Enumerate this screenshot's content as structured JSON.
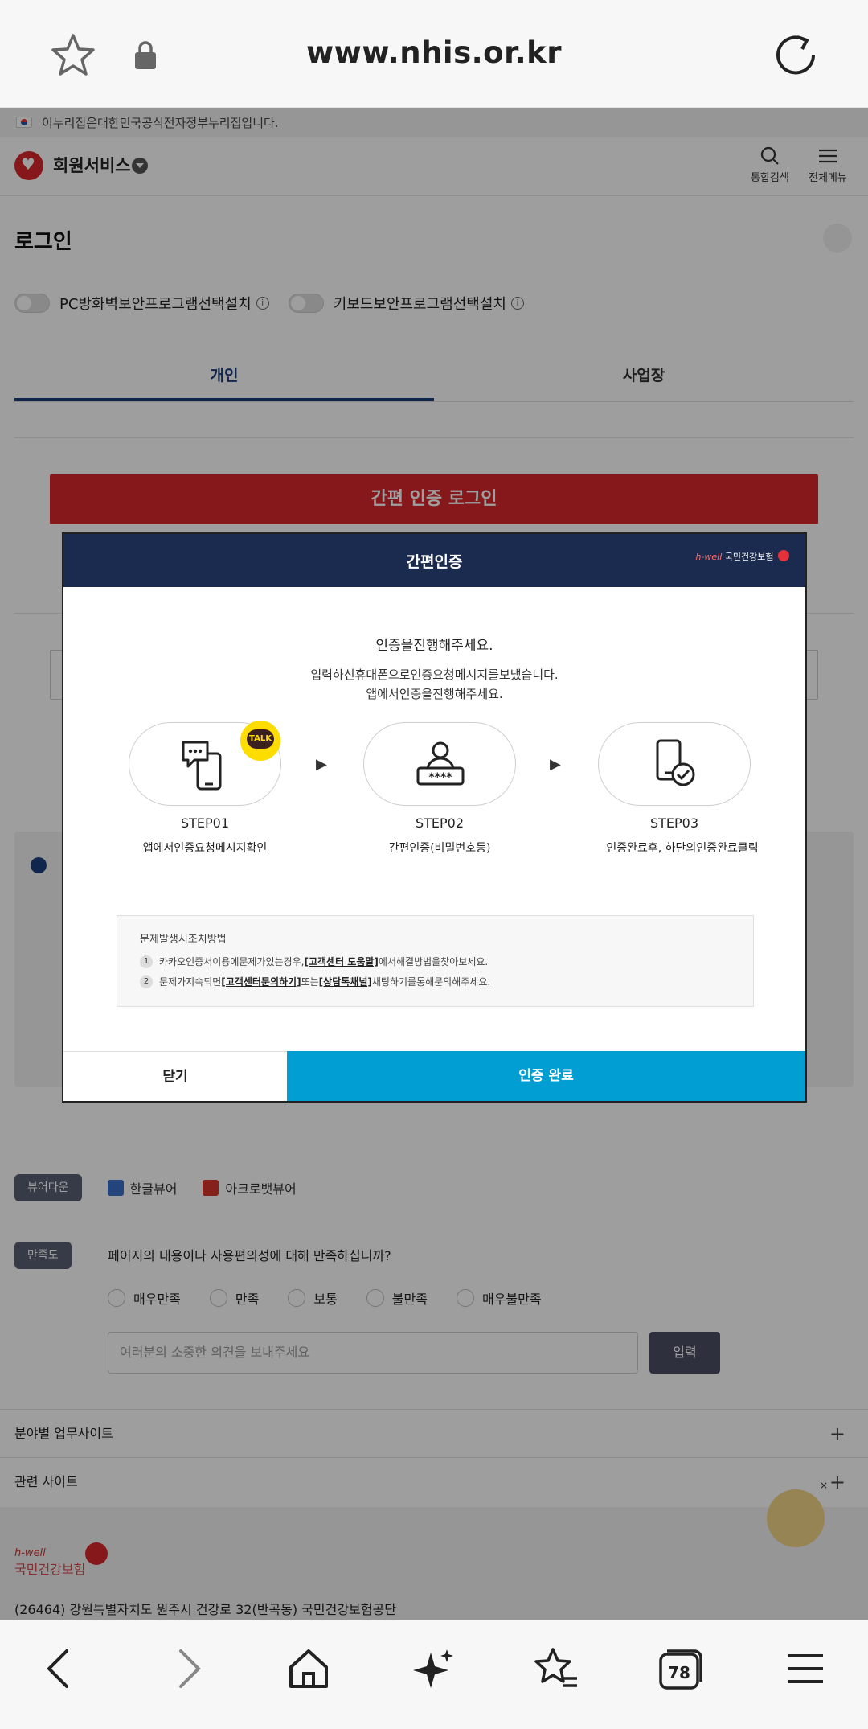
{
  "browser": {
    "url": "www.nhis.or.kr",
    "tab_count": "78"
  },
  "page": {
    "gov_banner": "이누리집은대한민국공식전자정부누리집입니다.",
    "header": {
      "site_title": "회원서비스",
      "search_label": "통합검색",
      "menu_label": "전체메뉴"
    },
    "login_title": "로그인",
    "toggles": {
      "pc_firewall": "PC방화벽보안프로그램선택설치",
      "keyboard_security": "키보드보안프로그램선택설치"
    },
    "tabs": [
      "개인",
      "사업장"
    ],
    "easy_login_button": "간편 인증 로그인",
    "viewer": {
      "label": "뷰어다운",
      "hangul_viewer": "한글뷰어",
      "acrobat_viewer": "아크로뱃뷰어"
    },
    "satisfaction": {
      "label": "만족도",
      "question": "페이지의 내용이나 사용편의성에 대해 만족하십니까?",
      "options": [
        "매우만족",
        "만족",
        "보통",
        "불만족",
        "매우불만족"
      ],
      "placeholder": "여러분의 소중한 의견을 보내주세요",
      "submit": "입력"
    },
    "accordion": {
      "field_sites": "분야별 업무사이트",
      "related_sites": "관련 사이트"
    },
    "footer": {
      "logo_small": "h-well",
      "logo_text": "국민건강보험",
      "address": "(26464) 강원특별자치도 원주시 건강로 32(반곡동) 국민건강보험공단"
    }
  },
  "modal": {
    "title": "간편인증",
    "brand_small": "h-well",
    "brand_text": "국민건강보험",
    "heading": "인증을진행해주세요.",
    "desc_line1": "입력하신휴대폰으로인증요청메시지를보냈습니다.",
    "desc_line2": "앱에서인증을진행해주세요.",
    "talk_badge": "TALK",
    "steps": [
      {
        "label": "STEP01",
        "desc": "앱에서인증요청메시지확인",
        "icon": "chat-phone-icon"
      },
      {
        "label": "STEP02",
        "desc": "간편인증(비밀번호등)",
        "icon": "user-password-icon"
      },
      {
        "label": "STEP03",
        "desc": "인증완료후, 하단의인증완료클릭",
        "icon": "phone-check-icon"
      }
    ],
    "help": {
      "title": "문제발생시조치방법",
      "line1_pre": "카카오인증서이용에문제가있는경우, ",
      "line1_link": "[고객센터 도움말]",
      "line1_post": "에서해결방법을찾아보세요.",
      "line2_pre": "문제가지속되면 ",
      "line2_link1": "[고객센터문의하기]",
      "line2_mid": " 또는 ",
      "line2_link2": "[상담톡채널]",
      "line2_post": " 채팅하기를통해문의해주세요."
    },
    "close_button": "닫기",
    "confirm_button": "인증 완료"
  }
}
